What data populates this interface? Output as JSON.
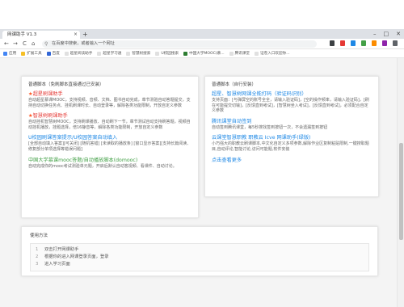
{
  "browser": {
    "tab_title": "网课助手 V1.3",
    "tab_close": "×",
    "new_tab": "+",
    "win_min": "–",
    "win_max": "□",
    "win_close": "✕",
    "back": "←",
    "forward": "→",
    "reload": "C",
    "home": "⌂",
    "search_glyph": "⚲",
    "address": "在百度中搜索，或者输入一个网址"
  },
  "bookmarks": [
    {
      "label": "应用",
      "color": "#4285f4"
    },
    {
      "label": "扩展工具",
      "color": "#f6bf26"
    },
    {
      "label": "百度",
      "color": "#3367d6"
    },
    {
      "label": "超星阅读助手",
      "color": "#e0e0e0"
    },
    {
      "label": "超星学习通",
      "color": "#e0e0e0"
    },
    {
      "label": "智慧树搜索",
      "color": "#e0e0e0"
    },
    {
      "label": "U校园搜索",
      "color": "#e0e0e0"
    },
    {
      "label": "中国大学MOOC(慕...",
      "color": "#2e7d32"
    },
    {
      "label": "腾讯课堂",
      "color": "#e0e0e0"
    },
    {
      "label": "证卷入口欢迎你...",
      "color": "#e0e0e0"
    }
  ],
  "left_panel": {
    "title": "普通脚本（免刷脚本直接通过已安装）",
    "items": [
      {
        "star": "★",
        "title": "超星刷课助手",
        "color": "#e53935",
        "desc": "自动超星慕课MOOC，支持视频、音频、文档、图书自动完成，章节测验自动答题提交，支持自动切换任务点、挂机刷课时长、自动登录等，解除各类功能限制，开放自定义参数"
      },
      {
        "star": "★",
        "title": "智慧树刷课助手",
        "color": "#e53935",
        "desc": "自动挂机智慧树MOOC，支持刷课播放、自动刷下一节，章节测试自动支持刷答题，视频自动挂机播放，挂题选择，倍16静音等，解除各类功能限制，开放自定义参数"
      },
      {
        "star": "",
        "title": "U校园刷课答案提示/U校园答案自动填入",
        "color": "#1e88e5",
        "desc": "[全部自动填入答案][可关闭] [随机答错] [未读取的播放条] [窗口显示答案][支持长篇阅读、修复部分单项选择等错误问题]"
      },
      {
        "star": "",
        "title": "中国大学慕课mooc答题/自动播放脚本(domooc)",
        "color": "#43a047",
        "desc": "自动完成你的mooc考试测验单元题，开启后默认自动答视频、看课件、自动讨论。"
      }
    ]
  },
  "right_panel": {
    "title": "普通脚本（自行安装）",
    "items": [
      {
        "title": "超星、智慧树网课全能打码（验证码识别）",
        "color": "#1e88e5",
        "desc": "支持页面：[与弹屏空的账号全全，请输入验证码]，[空的操作频率，请输入验证码]，[刷在可能提交切输]，[反馈直到考试]，[智慧树坐入考试]，[反馈直到考试]，必须配合自定义参数"
      },
      {
        "title": "腾讯课堂自动签到",
        "color": "#1e88e5",
        "desc": "自动签到腾讯课堂，每5秒搜找签到按钮一次，不会遗漏签到按钮"
      },
      {
        "title": "云课堂智慧职教 职教云 Icve 网课助手(绿版)",
        "color": "#1e88e5",
        "desc": "小巧强大的职教云刷课脚本,中文化自定义多项参数,解除作业区复制粘贴限制,一键搜取题目,自动评论,智能讨论,访问可能题,软件安装"
      },
      {
        "title": "点击查看更多",
        "color": "#1e88e5",
        "desc": ""
      }
    ]
  },
  "usage": {
    "title": "使用方法",
    "steps": [
      {
        "num": "1",
        "text": "双击打开网课助手"
      },
      {
        "num": "2",
        "text": "根据你的进入网课登录页面，登录"
      },
      {
        "num": "3",
        "text": "进入学习页面"
      }
    ]
  }
}
